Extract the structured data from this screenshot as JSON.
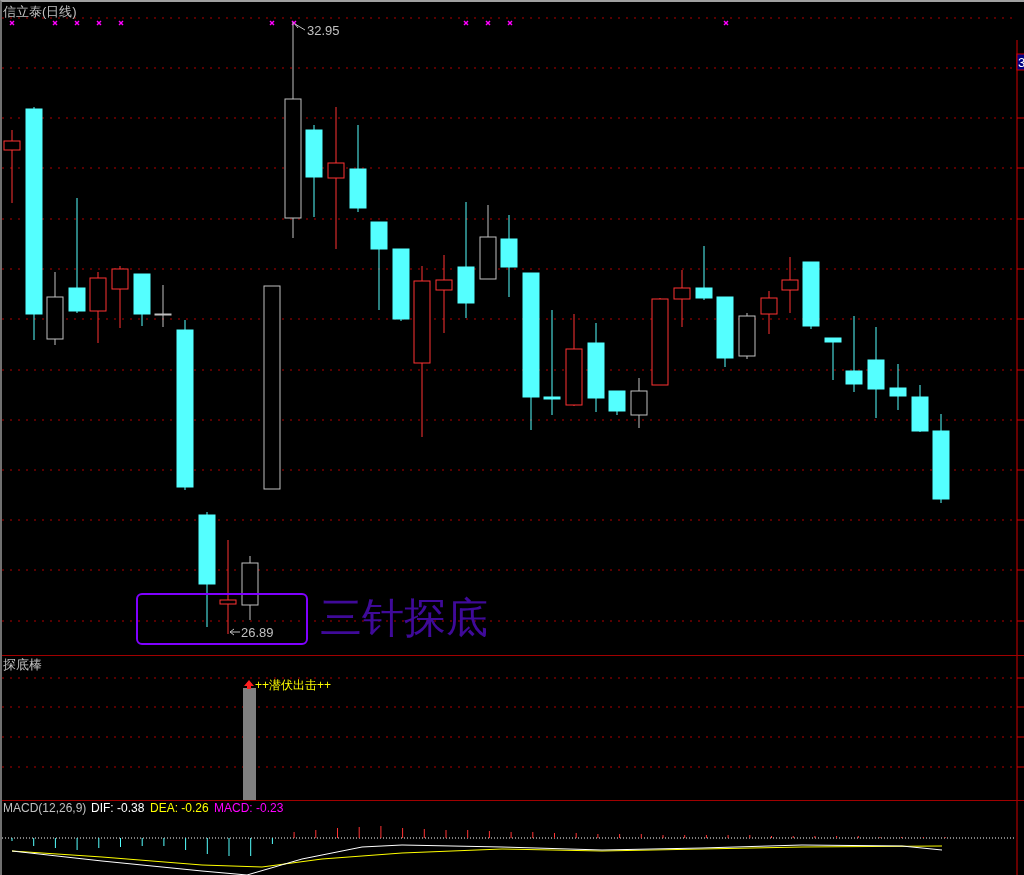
{
  "chart": {
    "title": "信立泰(日线)",
    "high_label": "32.95",
    "low_label": "26.89",
    "annotation": "三针探底",
    "price_tag": "3"
  },
  "indicator": {
    "title": "探底棒",
    "signal": "++潜伏出击++"
  },
  "macd": {
    "title": "MACD(12,26,9)",
    "dif": "DIF: -0.38",
    "dea": "DEA: -0.26",
    "macd": "MACD: -0.23"
  }
}
